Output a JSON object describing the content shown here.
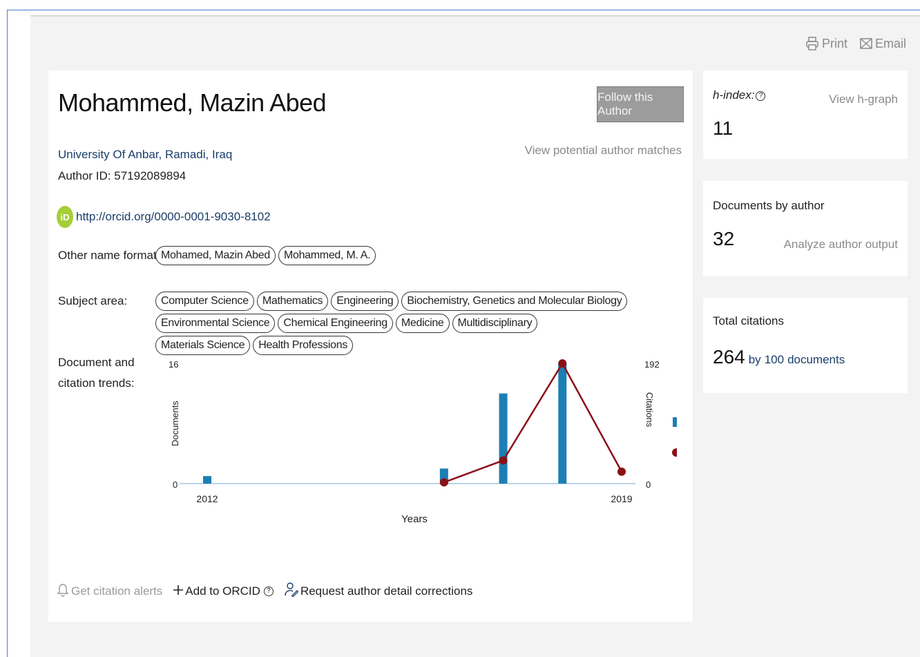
{
  "toolbar": {
    "print_label": "Print",
    "email_label": "Email"
  },
  "author": {
    "name": "Mohammed, Mazin Abed",
    "follow_label": "Follow this Author",
    "potential_matches_label": "View potential author matches",
    "affiliation": "University Of Anbar, Ramadi, Iraq",
    "author_id": "Author ID: 57192089894",
    "orcid_url": "http://orcid.org/0000-0001-9030-8102",
    "orcid_badge": "iD",
    "other_names_label": "Other name formats:",
    "other_names": [
      "Mohamed, Mazin Abed",
      "Mohammed, M. A."
    ],
    "subject_area_label": "Subject area:",
    "subject_areas": [
      "Computer Science",
      "Mathematics",
      "Engineering",
      "Biochemistry, Genetics and Molecular Biology",
      "Environmental Science",
      "Chemical Engineering",
      "Medicine",
      "Multidisciplinary",
      "Materials Science",
      "Health Professions"
    ],
    "trends_label": "Document and citation trends:"
  },
  "chart_data": {
    "type": "bar+line",
    "x_start": 2012,
    "x_end": 2019,
    "xlabel": "Years",
    "ylabel_left": "Documents",
    "ylabel_right": "Citations",
    "ylim_left": [
      0,
      16
    ],
    "ylim_right": [
      0,
      192
    ],
    "x_tick_labels": [
      "2012",
      "2019"
    ],
    "y_left_ticks": [
      "0",
      "16"
    ],
    "y_right_ticks": [
      "0",
      "192"
    ],
    "series": [
      {
        "name": "Documents",
        "kind": "bar",
        "color": "#1c7fb4",
        "x": [
          2012,
          2016,
          2017,
          2018,
          2019
        ],
        "values": [
          1,
          2,
          12,
          16,
          0
        ]
      },
      {
        "name": "Citations",
        "kind": "line",
        "color": "#8b0f17",
        "x": [
          2016,
          2017,
          2018,
          2019
        ],
        "values": [
          2,
          37,
          192,
          19
        ]
      }
    ],
    "legend_position": "right"
  },
  "actions": {
    "citation_alerts": "Get citation alerts",
    "add_orcid": "Add to ORCID",
    "request_corrections": "Request author detail corrections"
  },
  "metrics": {
    "hindex_label": "h-index:",
    "hindex_value": "11",
    "hgraph_label": "View h-graph",
    "docs_label": "Documents by author",
    "docs_value": "32",
    "analyze_label": "Analyze author output",
    "citations_label": "Total citations",
    "citations_value": "264",
    "citations_by": "by",
    "citations_docs_count": "100",
    "citations_docs_word": "documents"
  }
}
